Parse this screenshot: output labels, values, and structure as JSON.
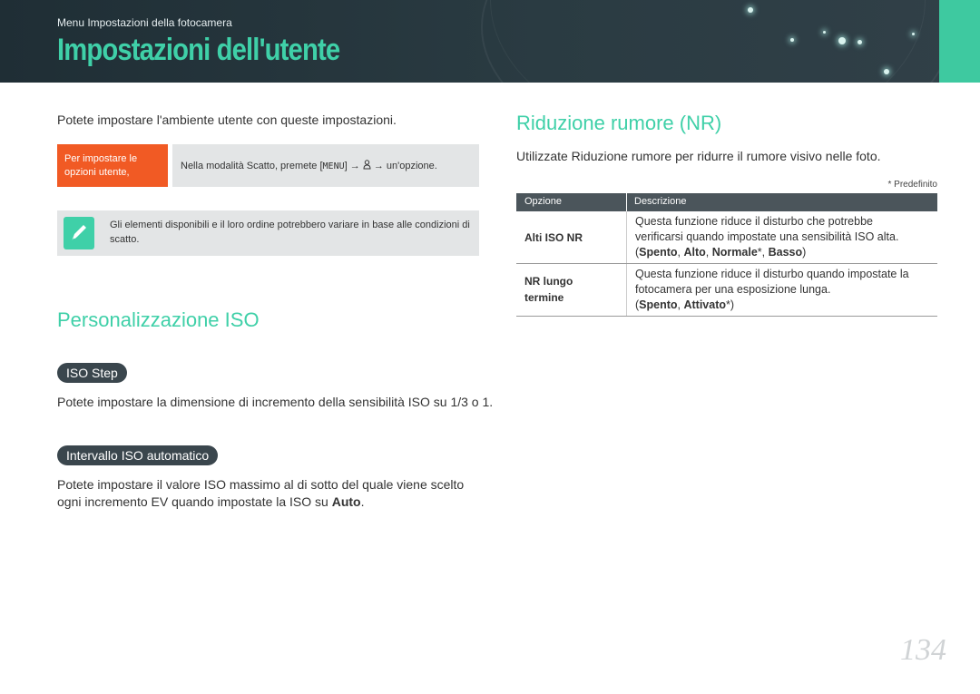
{
  "header": {
    "breadcrumb": "Menu Impostazioni della fotocamera",
    "title": "Impostazioni dell'utente",
    "accent_color": "#3fd0a8"
  },
  "left": {
    "intro": "Potete impostare l'ambiente utente con queste impostazioni.",
    "howto": {
      "label": "Per impostare le opzioni utente,",
      "body_prefix": "Nella modalità Scatto, premete [",
      "menu_key": "MENU",
      "body_middle": "] → ",
      "user_icon": "user-icon",
      "body_suffix": " → un'opzione."
    },
    "note": {
      "icon": "pen-note-icon",
      "text": "Gli elementi disponibili e il loro ordine potrebbero variare in base alle condizioni di scatto."
    },
    "iso_section": {
      "title": "Personalizzazione ISO",
      "iso_step": {
        "label": "ISO Step",
        "text": "Potete impostare la dimensione di incremento della sensibilità ISO su 1/3 o 1."
      },
      "auto_range": {
        "label": "Intervallo ISO automatico",
        "text_line1": "Potete impostare il valore ISO massimo al di sotto del quale viene scelto",
        "text_line2_prefix": "ogni incremento EV quando impostate la ISO su ",
        "text_line2_bold": "Auto",
        "text_line2_suffix": "."
      }
    }
  },
  "right": {
    "nr_section": {
      "title": "Riduzione rumore (NR)",
      "intro": "Utilizzate Riduzione rumore per ridurre il rumore visivo nelle foto.",
      "footnote": "* Predefinito",
      "table": {
        "headers": [
          "Opzione",
          "Descrizione"
        ],
        "rows": [
          {
            "option": "Alti ISO NR",
            "desc_line1": "Questa funzione riduce il disturbo che potrebbe",
            "desc_line2": "verificarsi quando impostate una sensibilità ISO alta.",
            "values": [
              "Spento",
              "Alto",
              "Normale",
              "Basso"
            ],
            "default_index": 2
          },
          {
            "option_line1": "NR lungo",
            "option_line2": "termine",
            "desc_line1": "Questa funzione riduce il disturbo quando impostate la",
            "desc_line2": "fotocamera per una esposizione lunga.",
            "values": [
              "Spento",
              "Attivato"
            ],
            "default_index": 1
          }
        ]
      }
    }
  },
  "page_number": "134"
}
